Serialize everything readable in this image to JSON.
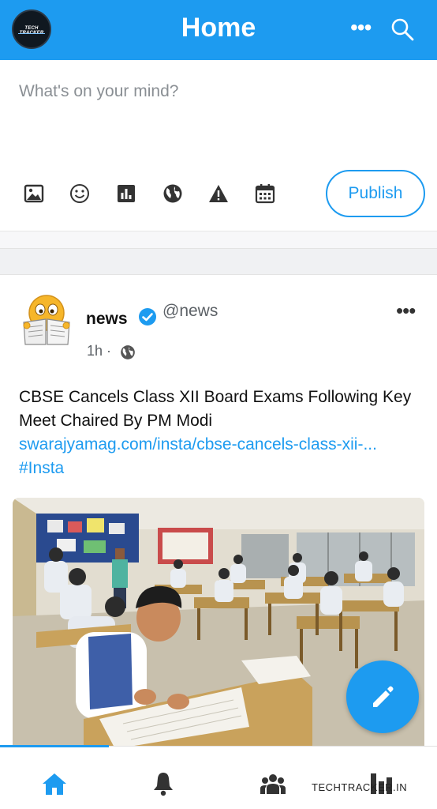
{
  "header": {
    "logo_text": "TECH TRACKER",
    "title": "Home",
    "more_label": "•••"
  },
  "composer": {
    "placeholder": "What's on your mind?",
    "tools": [
      "image-icon",
      "emoji-icon",
      "poll-icon",
      "globe-icon",
      "warning-icon",
      "calendar-icon"
    ],
    "publish_label": "Publish"
  },
  "post": {
    "author_name": "news",
    "handle": "@news",
    "time": "1h ·",
    "more_label": "•••",
    "text": "CBSE Cancels Class XII Board Exams Following Key Meet Chaired By PM Modi",
    "link": "swarajyamag.com/insta/cbse-cancels-class-xii-...",
    "hashtag": "#Insta"
  },
  "nav": {
    "items": [
      "home-icon",
      "bell-icon",
      "groups-icon",
      "chart-icon"
    ],
    "watermark": "TECHTRACKER.IN"
  },
  "colors": {
    "accent": "#1d9bf0",
    "text": "#111111",
    "muted": "#5c6166"
  }
}
